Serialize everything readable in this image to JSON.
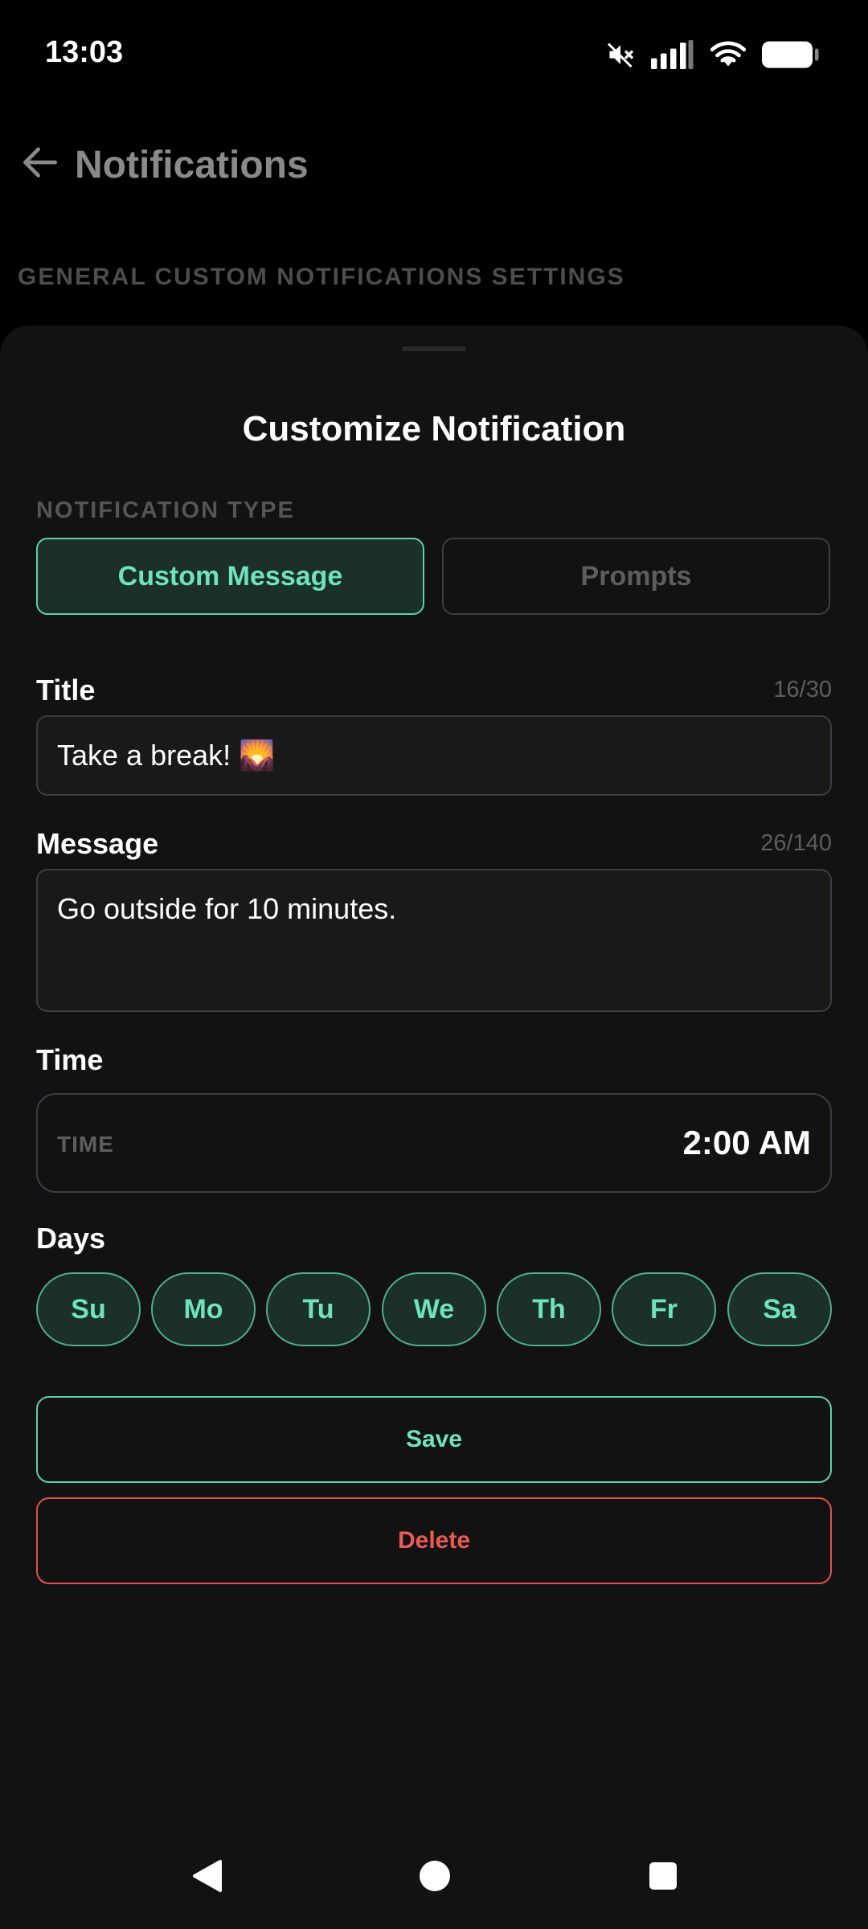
{
  "status_bar": {
    "time": "13:03",
    "icons": [
      "mute-icon",
      "signal-icon",
      "wifi-icon",
      "battery-icon"
    ]
  },
  "app_bar": {
    "title": "Notifications",
    "back_icon": "arrow-left-icon"
  },
  "background_section": {
    "label": "GENERAL CUSTOM NOTIFICATIONS SETTINGS"
  },
  "sheet": {
    "title": "Customize Notification",
    "notification_type": {
      "label": "NOTIFICATION TYPE",
      "options": [
        {
          "label": "Custom Message",
          "selected": true
        },
        {
          "label": "Prompts",
          "selected": false
        }
      ]
    },
    "title_field": {
      "label": "Title",
      "value": "Take a break! 🌄",
      "counter": "16/30"
    },
    "message_field": {
      "label": "Message",
      "value": "Go outside for 10 minutes.",
      "counter": "26/140"
    },
    "time_field": {
      "label": "Time",
      "inner_label": "TIME",
      "value": "2:00 AM"
    },
    "days": {
      "label": "Days",
      "items": [
        {
          "label": "Su",
          "selected": true
        },
        {
          "label": "Mo",
          "selected": true
        },
        {
          "label": "Tu",
          "selected": true
        },
        {
          "label": "We",
          "selected": true
        },
        {
          "label": "Th",
          "selected": true
        },
        {
          "label": "Fr",
          "selected": true
        },
        {
          "label": "Sa",
          "selected": true
        }
      ]
    },
    "save_label": "Save",
    "delete_label": "Delete"
  },
  "colors": {
    "accent": "#6fe3bf",
    "accent_bg": "#1b3029",
    "danger": "#ea5a55",
    "sheet_bg": "#121212"
  }
}
